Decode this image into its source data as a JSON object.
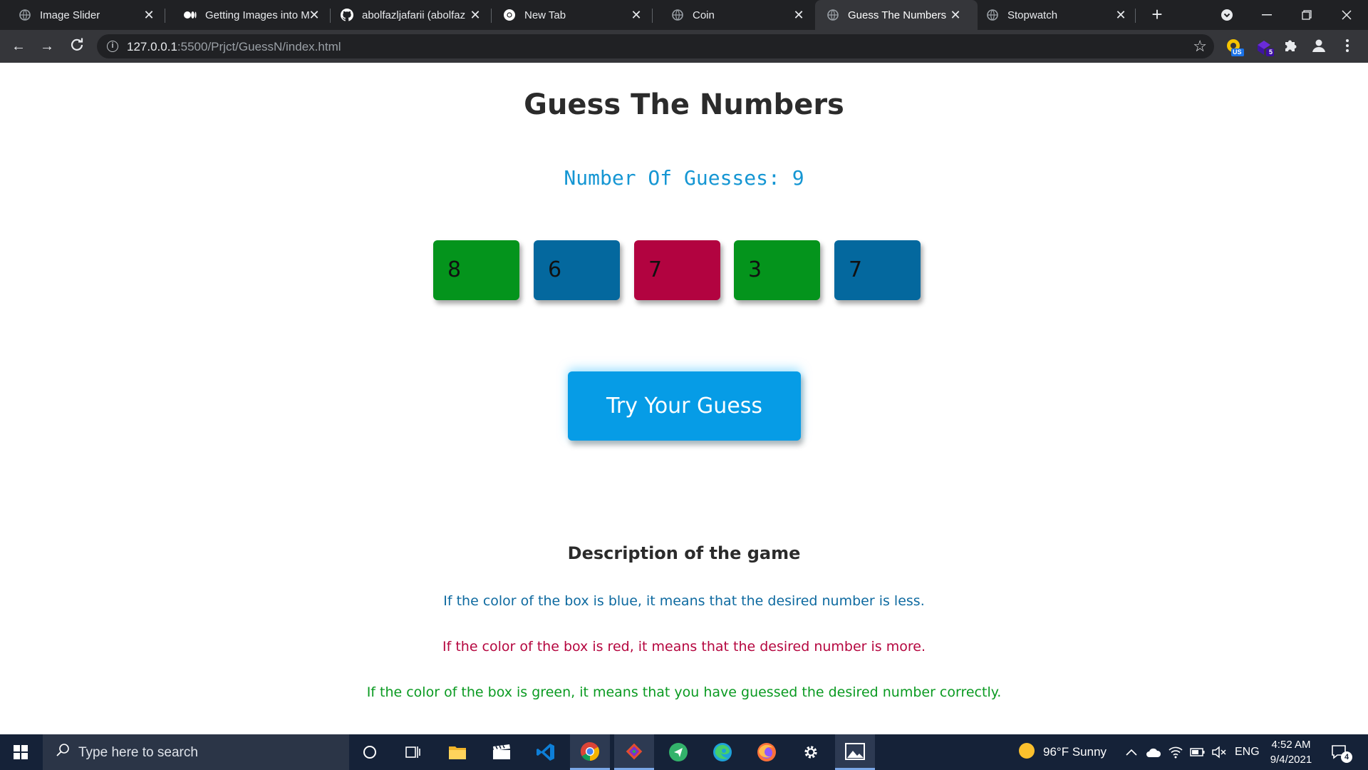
{
  "browser": {
    "tabs": [
      {
        "title": "Image Slider",
        "icon": "globe-icon"
      },
      {
        "title": "Getting Images into M",
        "icon": "medium-icon"
      },
      {
        "title": "abolfazljafarii (abolfaz",
        "icon": "github-icon"
      },
      {
        "title": "New Tab",
        "icon": "chrome-icon"
      },
      {
        "title": "Coin",
        "icon": "globe-icon"
      },
      {
        "title": "Guess The Numbers",
        "icon": "globe-icon",
        "active": true
      },
      {
        "title": "Stopwatch",
        "icon": "globe-icon"
      }
    ],
    "url_host": "127.0.0.1",
    "url_rest": ":5500/Prjct/GuessN/index.html",
    "ext_badges": {
      "first": "US",
      "second": "5"
    }
  },
  "page": {
    "title": "Guess The Numbers",
    "guesses_label": "Number Of Guesses: 9",
    "boxes": [
      {
        "value": "8",
        "status": "green"
      },
      {
        "value": "6",
        "status": "blue"
      },
      {
        "value": "7",
        "status": "red"
      },
      {
        "value": "3",
        "status": "green"
      },
      {
        "value": "7",
        "status": "blue"
      }
    ],
    "try_button": "Try Your Guess",
    "description_title": "Description of the game",
    "rules": [
      {
        "text": "If the color of the box is blue, it means that the desired number is less.",
        "color": "#0e6aa0"
      },
      {
        "text": "If the color of the box is red, it means that the desired number is more.",
        "color": "#b5063f"
      },
      {
        "text": "If the color of the box is green, it means that you have guessed the desired number correctly.",
        "color": "#0a9a21"
      }
    ]
  },
  "colors": {
    "green": "#04941c",
    "blue": "#04689e",
    "red": "#b20340",
    "button": "#069ce6"
  },
  "taskbar": {
    "search_placeholder": "Type here to search",
    "weather": "96°F  Sunny",
    "language": "ENG",
    "time": "4:52 AM",
    "date": "9/4/2021",
    "notifications": "4"
  }
}
